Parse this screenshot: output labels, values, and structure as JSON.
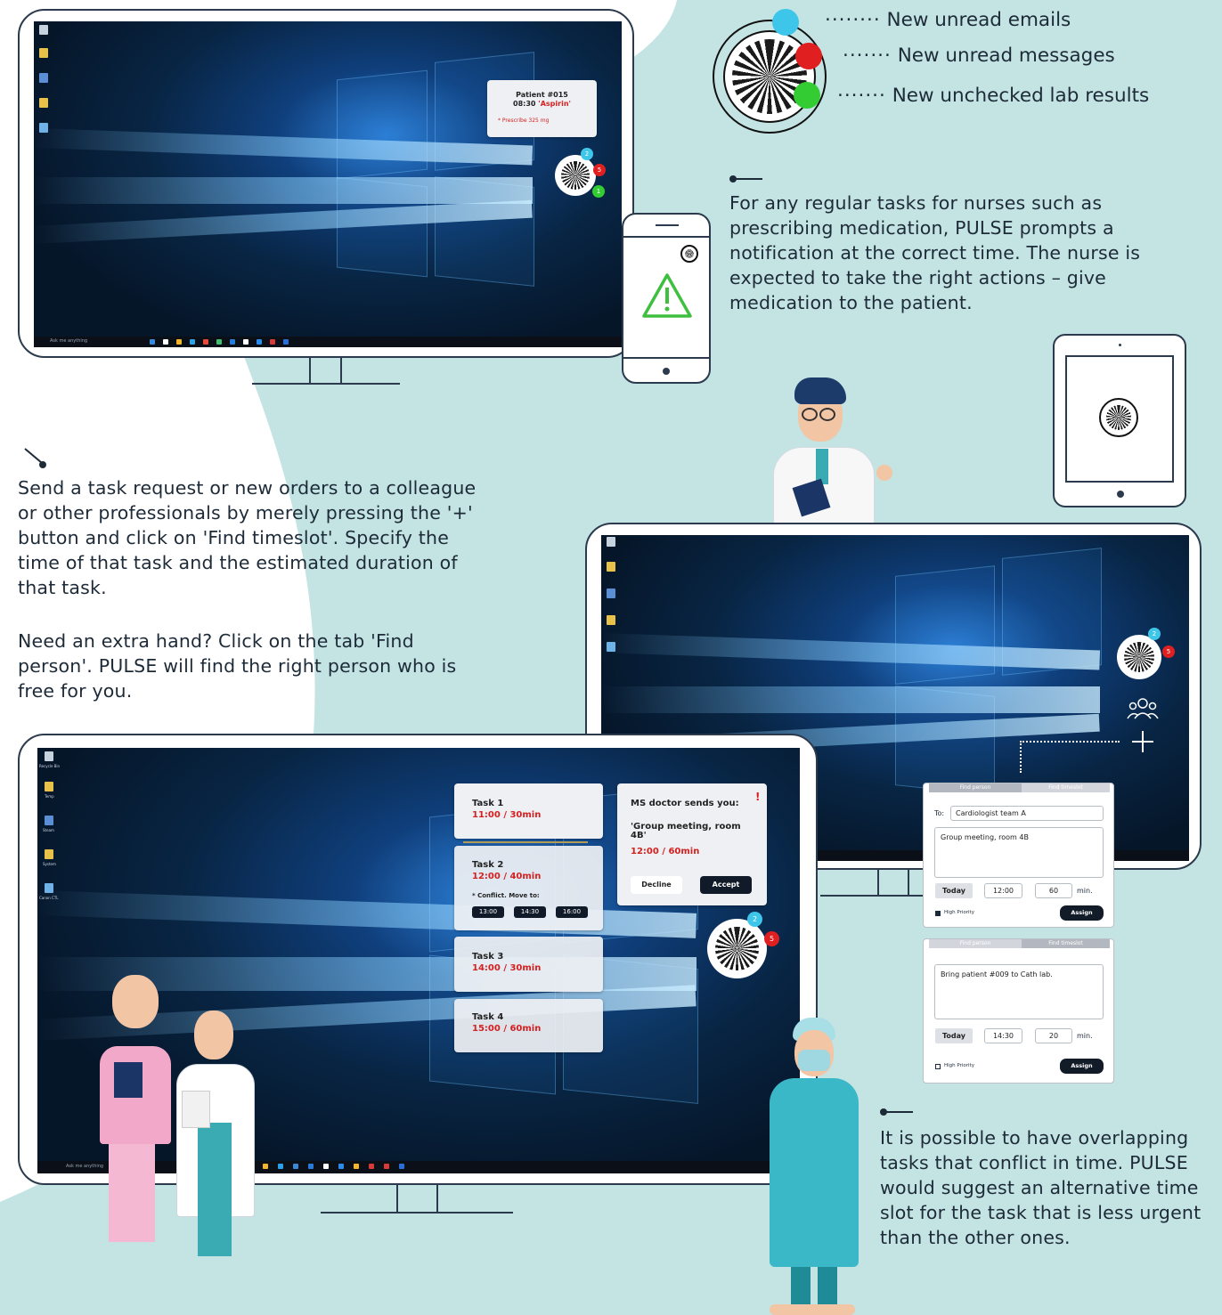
{
  "legend": {
    "emails": "New unread emails",
    "messages": "New unread messages",
    "lab": "New unchecked lab results",
    "colors": {
      "emails": "#3ec6ea",
      "messages": "#e02020",
      "lab": "#33cc33"
    }
  },
  "top_monitor": {
    "notification": {
      "patient": "Patient #015",
      "time": "08:30",
      "drug": "'Aspirin'",
      "note": "* Prescribe 325 mg"
    },
    "badges": {
      "emails": "2",
      "messages": "5",
      "lab": "1"
    }
  },
  "desktop_icons": [
    "Recycle Bin",
    "Temp",
    "Steam",
    "System",
    "Canon CTL"
  ],
  "taskbar_search": "Ask me anything",
  "paragraphs": {
    "regular_tasks": "For any regular tasks for nurses such as prescribing medication, PULSE prompts a notification at the correct time. The nurse is expected to take the right actions – give medication to the patient.",
    "send_task": "Send a task request or new orders to a colleague or other professionals by merely pressing the '+' button and click on 'Find timeslot'. Specify the time of that task and the estimated duration of that task.",
    "extra_hand": "Need an extra hand? Click on the tab 'Find person'. PULSE will find the right person who is free for you.",
    "overlap": "It is possible to have overlapping tasks that conflict in time. PULSE would suggest an alternative time slot for the task that is less urgent than the other ones."
  },
  "right_monitor": {
    "badges": {
      "emails": "2",
      "messages": "5"
    }
  },
  "form1": {
    "tabs": [
      "Find person",
      "Find timeslot"
    ],
    "to_label": "To:",
    "to_value": "Cardiologist team A",
    "message": "Group meeting, room 4B",
    "day": "Today",
    "time": "12:00",
    "duration": "60",
    "unit": "min.",
    "priority": "High Priority",
    "assign": "Assign"
  },
  "form2": {
    "tabs": [
      "Find person",
      "Find timeslot"
    ],
    "message": "Bring patient #009 to Cath lab.",
    "day": "Today",
    "time": "14:30",
    "duration": "20",
    "unit": "min.",
    "priority": "High Priority",
    "assign": "Assign"
  },
  "tasks": [
    {
      "title": "Task 1",
      "time": "11:00 / 30min"
    },
    {
      "title": "Task 2",
      "time": "12:00 / 40min",
      "conflict": "* Conflict. Move to:",
      "slots": [
        "13:00",
        "14:30",
        "16:00"
      ]
    },
    {
      "title": "Task 3",
      "time": "14:00 / 30min"
    },
    {
      "title": "Task 4",
      "time": "15:00 / 60min"
    }
  ],
  "message_card": {
    "header": "MS doctor sends you:",
    "alert": "!",
    "body": "'Group meeting, room 4B'",
    "time": "12:00 / 60min",
    "decline": "Decline",
    "accept": "Accept"
  },
  "bottom_monitor": {
    "badges": {
      "emails": "2",
      "messages": "5"
    }
  }
}
